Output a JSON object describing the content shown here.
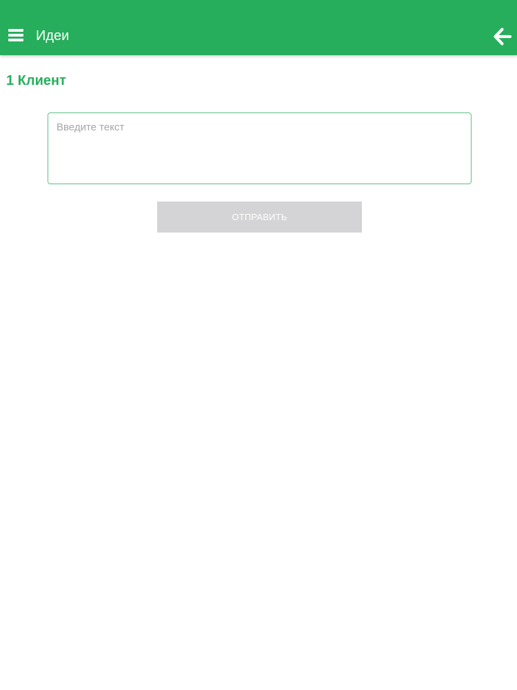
{
  "app_bar": {
    "title": "Идеи",
    "menu_icon": "hamburger-menu-icon",
    "back_icon": "arrow-left-icon",
    "background_color": "#27ae5c"
  },
  "section": {
    "title": "1 Клиент"
  },
  "form": {
    "input_placeholder": "Введите текст",
    "input_value": "",
    "submit_label": "ОТПРАВИТЬ",
    "submit_state": "disabled"
  }
}
